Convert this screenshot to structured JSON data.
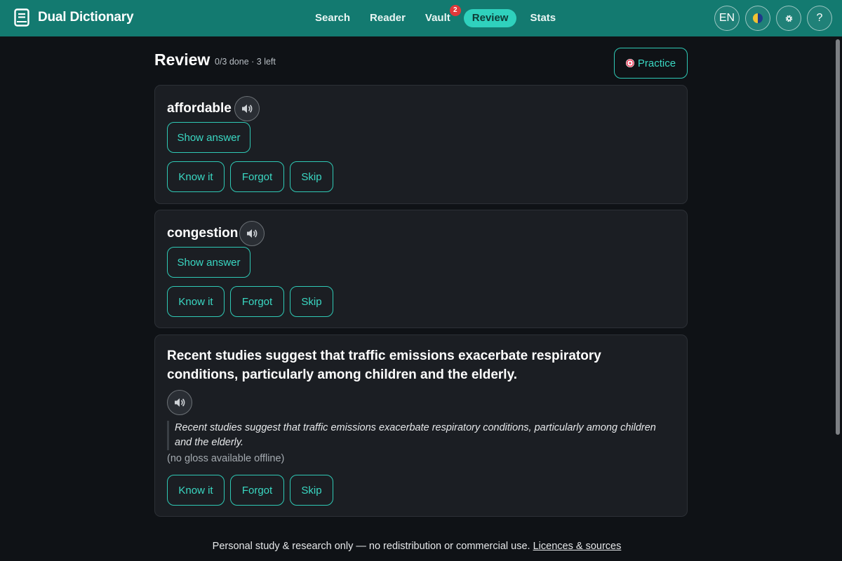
{
  "app": {
    "title": "Dual Dictionary"
  },
  "nav": [
    {
      "label": "Search",
      "active": false
    },
    {
      "label": "Reader",
      "active": false
    },
    {
      "label": "Vault",
      "active": false,
      "badge": "2"
    },
    {
      "label": "Review",
      "active": true
    },
    {
      "label": "Stats",
      "active": false
    }
  ],
  "top_actions": {
    "language": "EN",
    "theme_icon": "theme-toggle-icon",
    "settings_icon": "gear-icon",
    "help_label": "?"
  },
  "review": {
    "title": "Review",
    "progress": "0/3 done · 3 left",
    "practice_label": "Practice",
    "cards": [
      {
        "word": "affordable",
        "show_answer": "Show answer",
        "know": "Know it",
        "forgot": "Forgot",
        "skip": "Skip"
      },
      {
        "word": "congestion",
        "show_answer": "Show answer",
        "know": "Know it",
        "forgot": "Forgot",
        "skip": "Skip"
      },
      {
        "sentence": "Recent studies suggest that traffic emissions exacerbate respiratory conditions, particularly among children and the elderly.",
        "quote": "Recent studies suggest that traffic emissions exacerbate respiratory conditions, particularly among children and the elderly.",
        "gloss_note": "(no gloss available offline)",
        "know": "Know it",
        "forgot": "Forgot",
        "skip": "Skip"
      }
    ]
  },
  "footer": {
    "text": "Personal study & research only — no redistribution or commercial use.",
    "link": "Licences & sources"
  },
  "colors": {
    "topbar": "#137a70",
    "accent": "#2fc9b5",
    "background": "#0f1216",
    "card": "#1b1e23",
    "badge": "#e0383a"
  }
}
